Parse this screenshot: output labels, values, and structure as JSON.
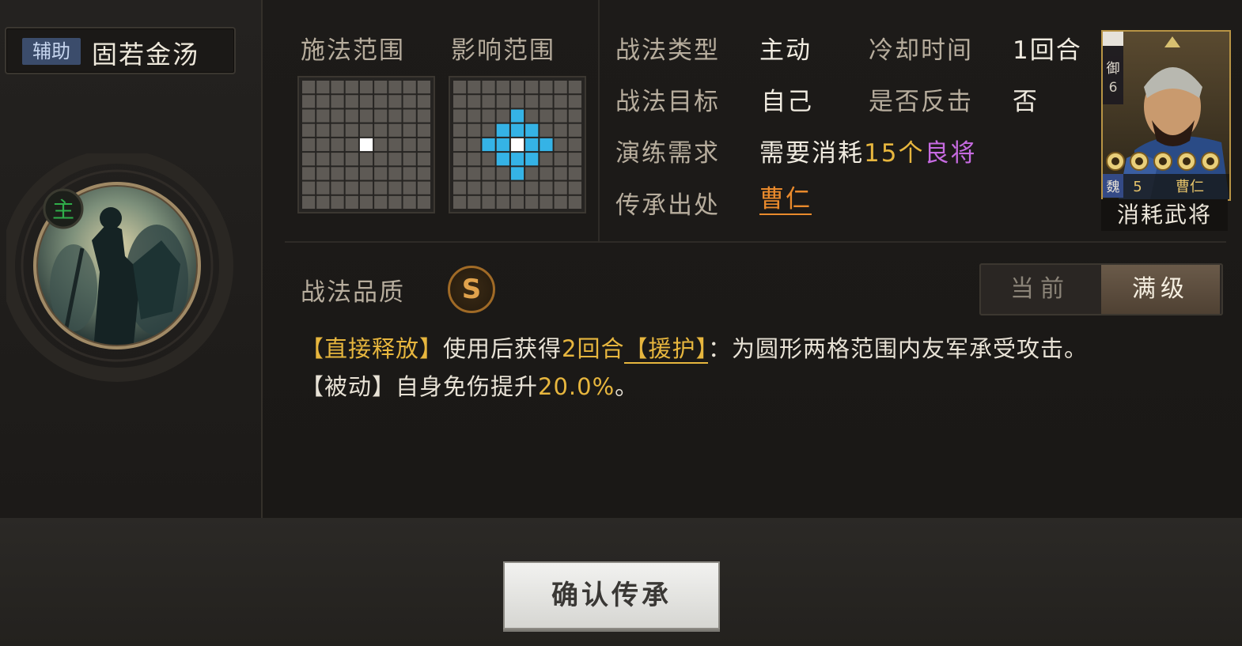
{
  "skill": {
    "type_tag": "辅助",
    "name": "固若金汤",
    "emblem_mark": "主"
  },
  "range": {
    "cast_label": "施法范围",
    "effect_label": "影响范围"
  },
  "attributes": {
    "type_label": "战法类型",
    "type_value": "主动",
    "cooldown_label": "冷却时间",
    "cooldown_value": "1回合",
    "target_label": "战法目标",
    "target_value": "自己",
    "counter_label": "是否反击",
    "counter_value": "否",
    "training_label": "演练需求",
    "training_prefix": "需要消耗",
    "training_count": "15个",
    "training_item": "良将",
    "inherit_label": "传承出处",
    "inherit_value": "曹仁"
  },
  "general_card": {
    "troop_char": "御",
    "troop_level": "6",
    "faction": "魏",
    "cost": "5",
    "name": "曹仁",
    "stars": 5,
    "consume_label": "消耗武将"
  },
  "quality": {
    "label": "战法品质",
    "grade": "S"
  },
  "level_toggle": {
    "current_label": "当前",
    "max_label": "满级"
  },
  "description": {
    "line1_tag": "【直接释放】",
    "line1_text_a": "使用后获得",
    "line1_num": "2回合",
    "line1_status": "【援护】",
    "line1_text_b": "：为圆形两格范围内友军承受攻击。",
    "line2_tag": "【被动】",
    "line2_text": "自身免伤提升",
    "line2_num": "20.0%",
    "line2_end": "。"
  },
  "confirm_button": "确认传承",
  "colors": {
    "gold": "#e7b63e",
    "purple": "#c66ae0",
    "orange": "#e98a2c",
    "cyan": "#35b3e6"
  }
}
